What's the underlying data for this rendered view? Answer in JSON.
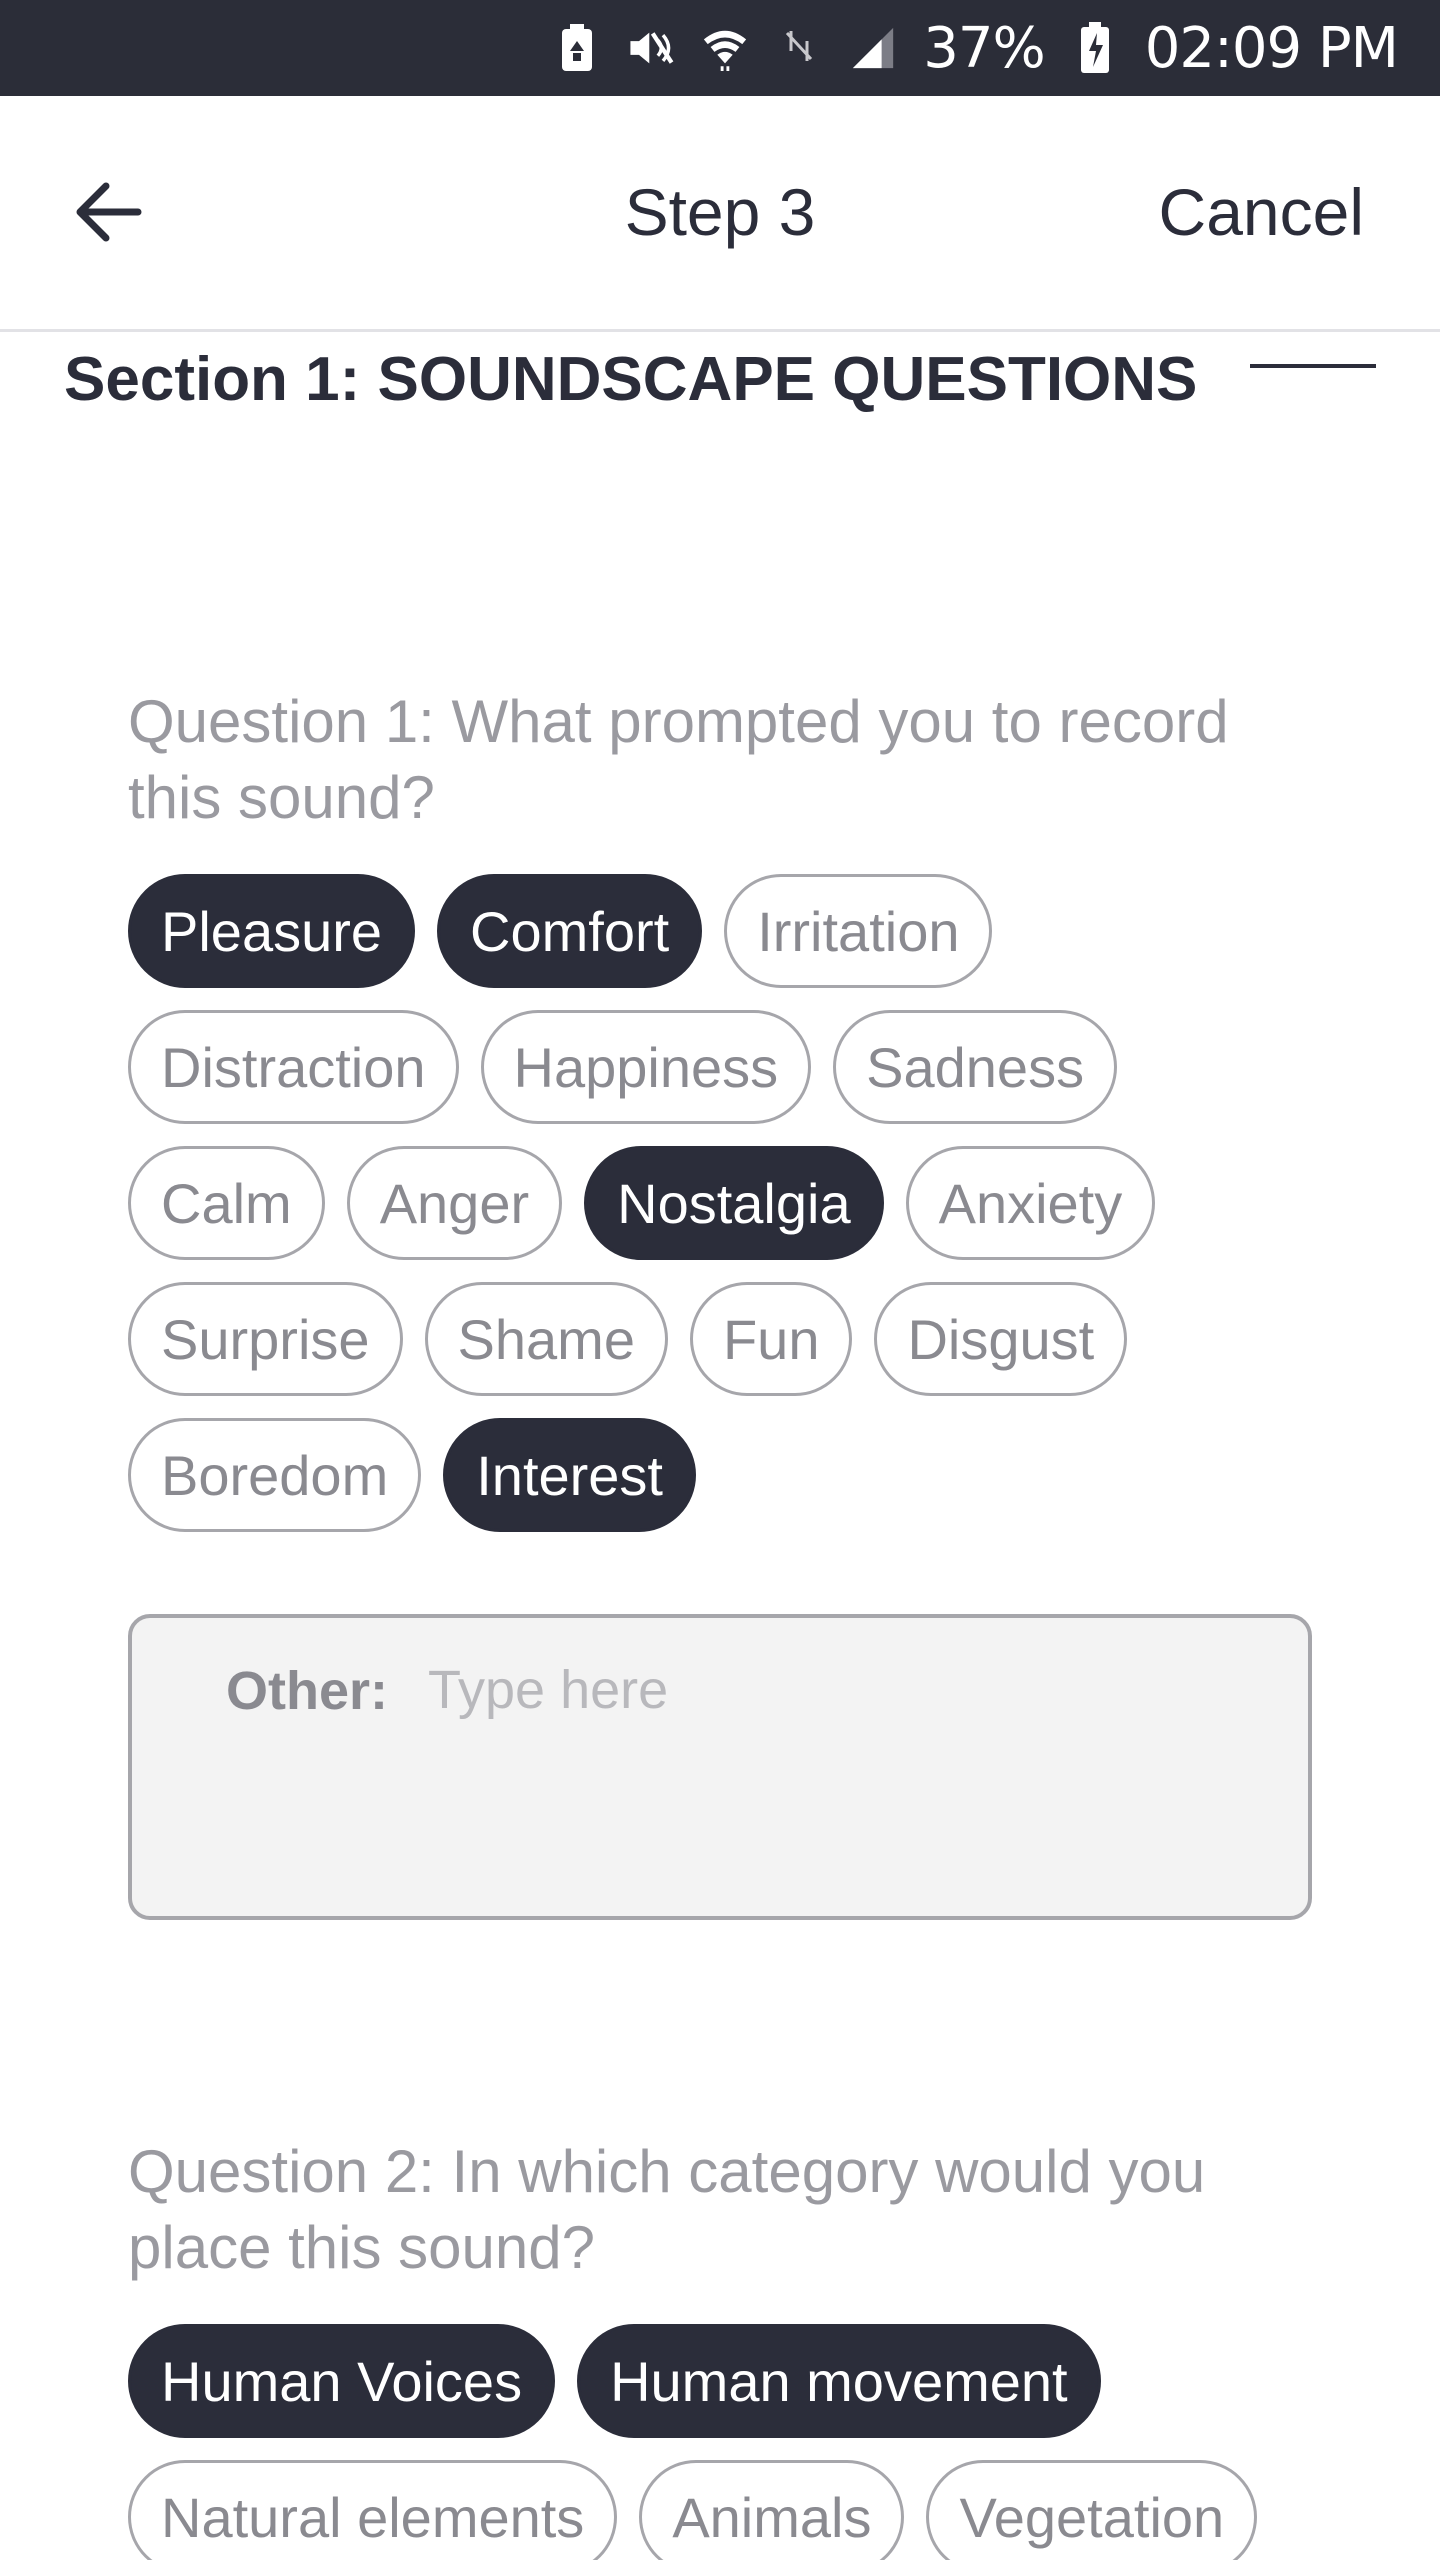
{
  "status_bar": {
    "battery_percent": "37%",
    "time": "02:09 PM",
    "icons": [
      "battery-saver-icon",
      "mute-icon",
      "wifi-icon",
      "nfc-icon",
      "signal-icon",
      "charging-battery-icon"
    ]
  },
  "header": {
    "title": "Step 3",
    "cancel_label": "Cancel",
    "back_icon": "arrow-left-icon"
  },
  "section": {
    "title": "Section 1: SOUNDSCAPE QUESTIONS"
  },
  "question1": {
    "label": "Question 1: What prompted you to record this sound?",
    "options": [
      {
        "label": "Pleasure",
        "selected": true
      },
      {
        "label": "Comfort",
        "selected": true
      },
      {
        "label": "Irritation",
        "selected": false
      },
      {
        "label": "Distraction",
        "selected": false
      },
      {
        "label": "Happiness",
        "selected": false
      },
      {
        "label": "Sadness",
        "selected": false
      },
      {
        "label": "Calm",
        "selected": false
      },
      {
        "label": "Anger",
        "selected": false
      },
      {
        "label": "Nostalgia",
        "selected": true
      },
      {
        "label": "Anxiety",
        "selected": false
      },
      {
        "label": "Surprise",
        "selected": false
      },
      {
        "label": "Shame",
        "selected": false
      },
      {
        "label": "Fun",
        "selected": false
      },
      {
        "label": "Disgust",
        "selected": false
      },
      {
        "label": "Boredom",
        "selected": false
      },
      {
        "label": "Interest",
        "selected": true
      }
    ],
    "other": {
      "label": "Other:",
      "placeholder": "Type here",
      "value": ""
    }
  },
  "question2": {
    "label": "Question 2: In which category would you place this sound?",
    "options": [
      {
        "label": "Human Voices",
        "selected": true
      },
      {
        "label": "Human movement",
        "selected": true
      },
      {
        "label": "Natural elements",
        "selected": false
      },
      {
        "label": "Animals",
        "selected": false
      },
      {
        "label": "Vegetation",
        "selected": false
      }
    ]
  },
  "colors": {
    "primary_dark": "#2b2d3a",
    "chip_border": "#a6a6ab",
    "muted_text": "#9a9aa0",
    "input_bg": "#f3f3f3"
  }
}
